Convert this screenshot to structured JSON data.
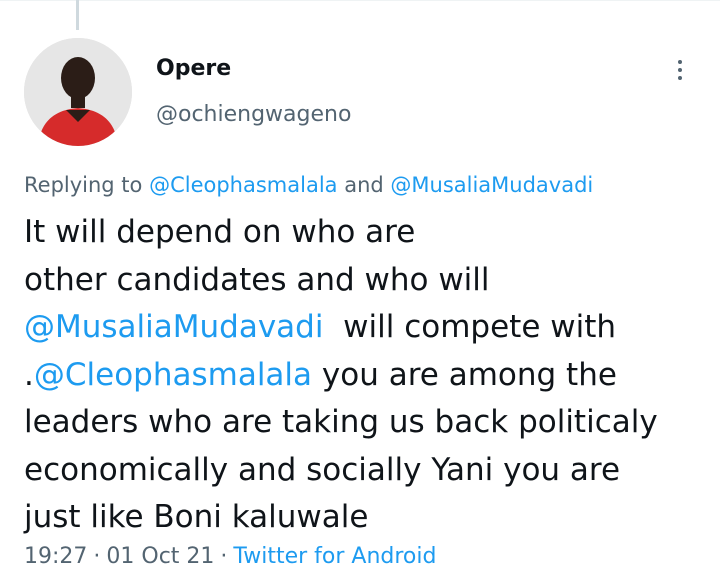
{
  "author": {
    "name": "Opere",
    "handle": "@ochiengwageno"
  },
  "reply_context": {
    "prefix": "Replying to ",
    "mention_1": "@Cleophasmalala",
    "joiner": " and ",
    "mention_2": "@MusaliaMudavadi"
  },
  "tweet": {
    "line_1": "It will depend on who are",
    "line_2": "other candidates and who will",
    "line_3_mention": "@MusaliaMudavadi",
    "line_3_text": "  will compete with",
    "line_4_prefix": ".",
    "line_4_mention": "@Cleophasmalala",
    "line_4_text": " you are among the",
    "line_5": "leaders who are taking us back politicaly",
    "line_6": "economically and socially Yani you are",
    "line_7": "just like Boni kaluwale"
  },
  "meta": {
    "time": "19:27",
    "separator": "·",
    "date": "01 Oct 21",
    "source": "Twitter for Android"
  },
  "colors": {
    "link": "#1d9bf0",
    "secondary_text": "#536471",
    "primary_text": "#0f1419"
  },
  "icons": {
    "more": "more-vertical-icon"
  }
}
